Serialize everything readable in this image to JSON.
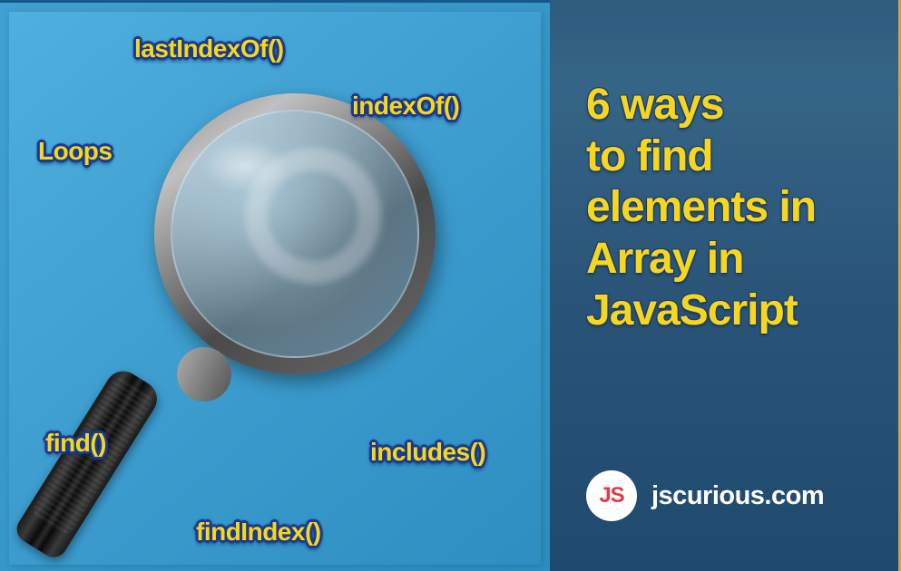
{
  "labels": {
    "lastIndexOf": "lastIndexOf()",
    "indexOf": "indexOf()",
    "loops": "Loops",
    "find": "find()",
    "includes": "includes()",
    "findIndex": "findIndex()"
  },
  "title": {
    "line1": "6 ways",
    "line2": "to find",
    "line3": "elements in",
    "line4": "Array in",
    "line5": "JavaScript"
  },
  "brand": {
    "logoText": "JS",
    "name": "jscurious.com"
  }
}
